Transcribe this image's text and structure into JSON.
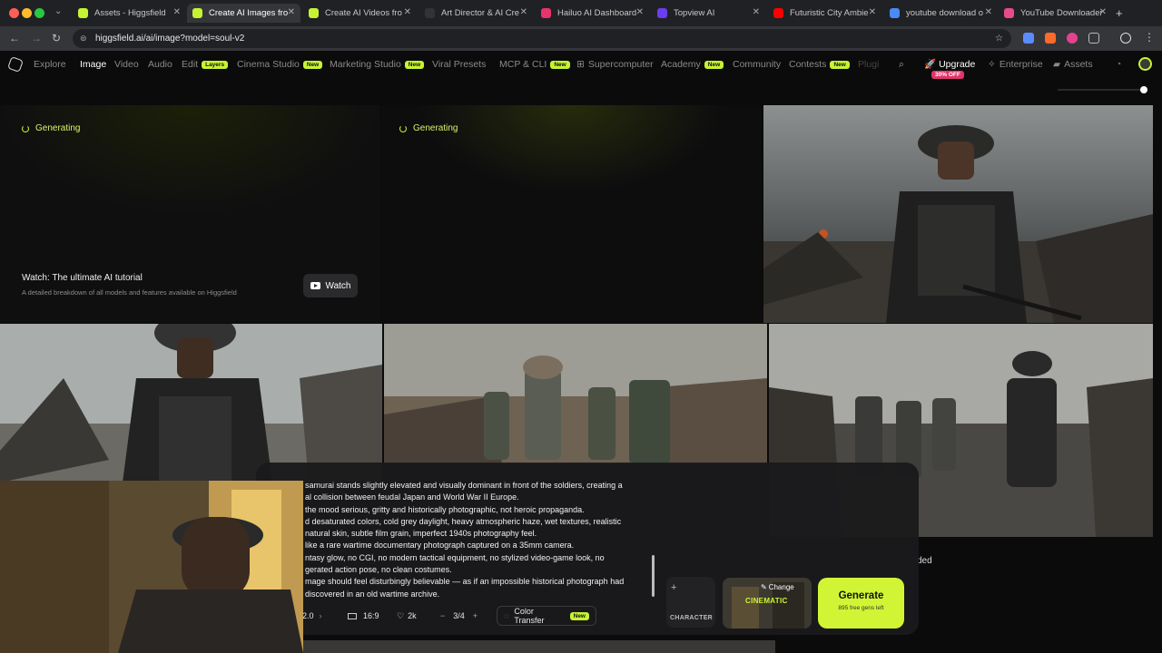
{
  "browser": {
    "tabs": [
      {
        "title": "Assets - Higgsfield",
        "active": false
      },
      {
        "title": "Create AI Images fro",
        "active": true
      },
      {
        "title": "Create AI Videos fro",
        "active": false
      },
      {
        "title": "Art Director & AI Cre",
        "active": false
      },
      {
        "title": "Hailuo AI Dashboard",
        "active": false
      },
      {
        "title": "Topview AI",
        "active": false
      },
      {
        "title": "Futuristic City Ambie",
        "active": false
      },
      {
        "title": "youtube download o",
        "active": false
      },
      {
        "title": "YouTube Downloader",
        "active": false
      }
    ],
    "url": "higgsfield.ai/ai/image?model=soul-v2"
  },
  "nav": {
    "items": [
      {
        "label": "Explore"
      },
      {
        "label": "Image"
      },
      {
        "label": "Video"
      },
      {
        "label": "Audio"
      },
      {
        "label": "Edit",
        "badge": "Layers"
      },
      {
        "label": "Cinema Studio",
        "badge": "New"
      },
      {
        "label": "Marketing Studio",
        "badge": "New"
      },
      {
        "label": "Viral Presets"
      },
      {
        "label": "MCP & CLI",
        "badge": "New"
      },
      {
        "label": "Supercomputer"
      },
      {
        "label": "Academy",
        "badge": "New"
      },
      {
        "label": "Community"
      },
      {
        "label": "Contests",
        "badge": "New"
      },
      {
        "label": "Plugi"
      }
    ],
    "upgrade": "Upgrade",
    "upgrade_badge": "30% OFF",
    "enterprise": "Enterprise",
    "assets": "Assets"
  },
  "grid": {
    "generating_label": "Generating",
    "watch_title": "Watch: The ultimate AI tutorial",
    "watch_sub": "A detailed breakdown of all models and features available on Higgsfield",
    "watch_button": "Watch",
    "partial_label": "ded"
  },
  "prompt": {
    "text": "samurai stands slightly elevated and visually dominant in front of the soldiers, creating a\nal collision between feudal Japan and World War II Europe.\nthe mood serious, gritty and historically photographic, not heroic propaganda.\nd desaturated colors, cold grey daylight, heavy atmospheric haze, wet textures, realistic\nnatural skin, subtle film grain, imperfect 1940s photography feel.\nlike a rare wartime documentary photograph captured on a 35mm camera.\nntasy glow, no CGI, no modern tactical equipment, no stylized video-game look, no\ngerated action pose, no clean costumes.\nmage should feel disturbingly believable — as if an impossible historical photograph had\ndiscovered in an old wartime archive.",
    "model_version": "2.0",
    "aspect": "16:9",
    "quality": "2k",
    "count": "3/4",
    "color_transfer": "Color Transfer",
    "color_transfer_badge": "New",
    "character_label": "CHARACTER",
    "preset_change": "Change",
    "preset_name": "CINEMATIC",
    "generate_label": "Generate",
    "generate_sub": "895 free gens left"
  },
  "colors": {
    "accent": "#d1f534",
    "background": "#0b0b0c",
    "panel": "#1a1a1c"
  }
}
